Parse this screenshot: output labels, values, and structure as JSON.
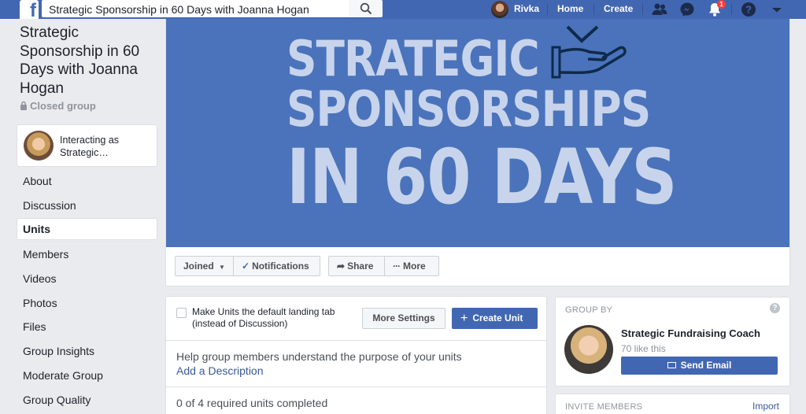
{
  "topbar": {
    "logo": "f",
    "search_value": "Strategic Sponsorship in 60 Days with Joanna Hogan",
    "search_icon": "search-icon",
    "user_name": "Rivka",
    "home_label": "Home",
    "create_label": "Create",
    "notification_count": "1",
    "brand_color": "#4267b2"
  },
  "group": {
    "title": "Strategic Sponsorship in 60 Days with Joanna Hogan",
    "privacy": "Closed group",
    "interacting_as": "Interacting as Strategic…"
  },
  "nav": {
    "items": [
      {
        "label": "About"
      },
      {
        "label": "Discussion"
      },
      {
        "label": "Units",
        "active": true
      },
      {
        "label": "Members"
      },
      {
        "label": "Videos"
      },
      {
        "label": "Photos"
      },
      {
        "label": "Files"
      },
      {
        "label": "Group Insights"
      },
      {
        "label": "Moderate Group"
      },
      {
        "label": "Group Quality"
      }
    ]
  },
  "cover": {
    "line1": "STRATEGIC",
    "line2": "SPONSORSHIPS",
    "line3": "IN 60 DAYS",
    "bg_color": "#4a73bb"
  },
  "actions": {
    "joined": "Joined",
    "notifications": "Notifications",
    "share": "Share",
    "more": "More"
  },
  "units": {
    "checkbox_label": "Make Units the default landing tab (instead of Discussion)",
    "more_settings": "More Settings",
    "create_unit": "Create Unit",
    "help_text": "Help group members understand the purpose of your units",
    "add_description": "Add a Description",
    "progress": "0 of 4 required units completed"
  },
  "group_by": {
    "heading": "GROUP BY",
    "help": "?",
    "name": "Strategic Fundraising Coach",
    "likes": "70 like this",
    "send_email": "Send Email"
  },
  "invite": {
    "heading": "INVITE MEMBERS",
    "import": "Import"
  }
}
